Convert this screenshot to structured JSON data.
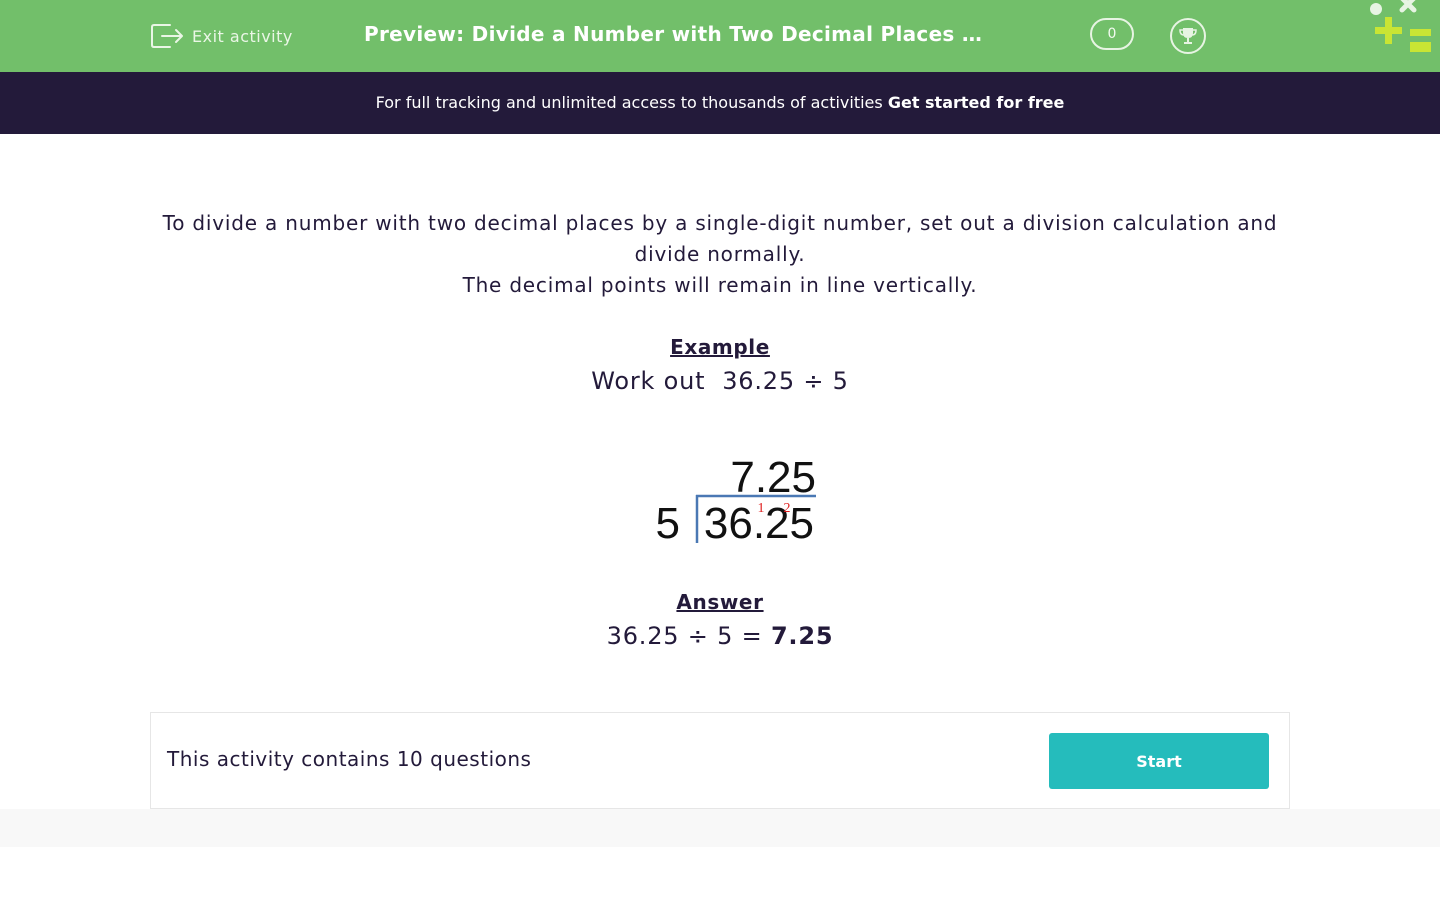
{
  "header": {
    "exit_label": "Exit activity",
    "title": "Preview: Divide a Number with Two Decimal Places by a Single-Digit Number",
    "score": "0",
    "background_color": "#72bf6a"
  },
  "promo": {
    "text": "For full tracking and unlimited access to thousands of activities ",
    "link_label": "Get started for free",
    "background_color": "#231a3a"
  },
  "content": {
    "intro_line1": "To divide a number with two decimal places by a single-digit number, set out a division calculation and divide normally.",
    "intro_line2": "The decimal points will remain in line vertically.",
    "example_heading": "Example",
    "example_prompt": "Work out  36.25 ÷ 5",
    "division": {
      "quotient": "7.25",
      "divisor": "5",
      "dividend": "36.25",
      "carry_1": "1",
      "carry_2": "2"
    },
    "answer_heading": "Answer",
    "answer_expression": "36.25 ÷ 5 = ",
    "answer_value": "7.25"
  },
  "footer": {
    "question_count_text": "This activity contains 10 questions",
    "start_label": "Start",
    "start_color": "#25bcbc"
  }
}
